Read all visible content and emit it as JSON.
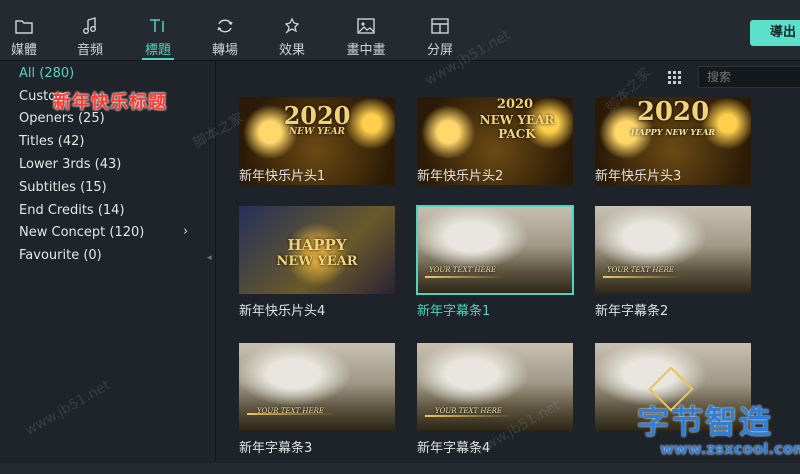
{
  "toolbar": {
    "tabs": [
      {
        "label": "媒體",
        "icon": "folder-icon"
      },
      {
        "label": "音頻",
        "icon": "music-note-icon"
      },
      {
        "label": "標題",
        "icon": "text-title-icon"
      },
      {
        "label": "轉場",
        "icon": "transition-icon"
      },
      {
        "label": "效果",
        "icon": "effects-icon"
      },
      {
        "label": "畫中畫",
        "icon": "picture-in-picture-icon"
      },
      {
        "label": "分屏",
        "icon": "split-screen-icon"
      }
    ],
    "active_tab": "標題",
    "export_label": "導出"
  },
  "sidebar": {
    "categories": [
      {
        "label": "All (280)"
      },
      {
        "label": "Custom"
      },
      {
        "label": "Openers (25)"
      },
      {
        "label": "Titles (42)"
      },
      {
        "label": "Lower 3rds (43)"
      },
      {
        "label": "Subtitles (15)"
      },
      {
        "label": "End Credits (14)"
      },
      {
        "label": "New Concept (120)"
      },
      {
        "label": "Favourite (0)"
      }
    ],
    "overlay_title": "新年快乐标题"
  },
  "search": {
    "placeholder": "搜索"
  },
  "items": [
    {
      "label": "新年快乐片头1",
      "style": "gold",
      "title": "2020",
      "sub": "NEW YEAR"
    },
    {
      "label": "新年快乐片头2",
      "style": "gold",
      "title": "2020",
      "sub": "NEW YEAR PACK"
    },
    {
      "label": "新年快乐片头3",
      "style": "gold",
      "title": "2020",
      "sub": "HAPPY NEW YEAR"
    },
    {
      "label": "新年快乐片头4",
      "style": "blue",
      "title": "HAPPY",
      "sub": "NEW YEAR"
    },
    {
      "label": "新年字幕条1",
      "style": "photo",
      "caption": "YOUR TEXT HERE",
      "selected": true
    },
    {
      "label": "新年字幕条2",
      "style": "photo",
      "caption": "YOUR TEXT HERE"
    },
    {
      "label": "新年字幕条3",
      "style": "photo",
      "caption": "YOUR TEXT HERE"
    },
    {
      "label": "新年字幕条4",
      "style": "photo",
      "caption": "YOUR TEXT HERE"
    },
    {
      "label": "",
      "style": "photo",
      "caption": ""
    }
  ],
  "watermarks": {
    "site": "www.jb51.net",
    "site_cn": "脚本之家",
    "brand": "字节智造",
    "brand_url": "www.zsxcool.com"
  },
  "colors": {
    "accent": "#4fd3c2",
    "export": "#5ce0cb",
    "overlay_red": "#ff3a2e",
    "brand_blue": "#2f7fd8"
  }
}
